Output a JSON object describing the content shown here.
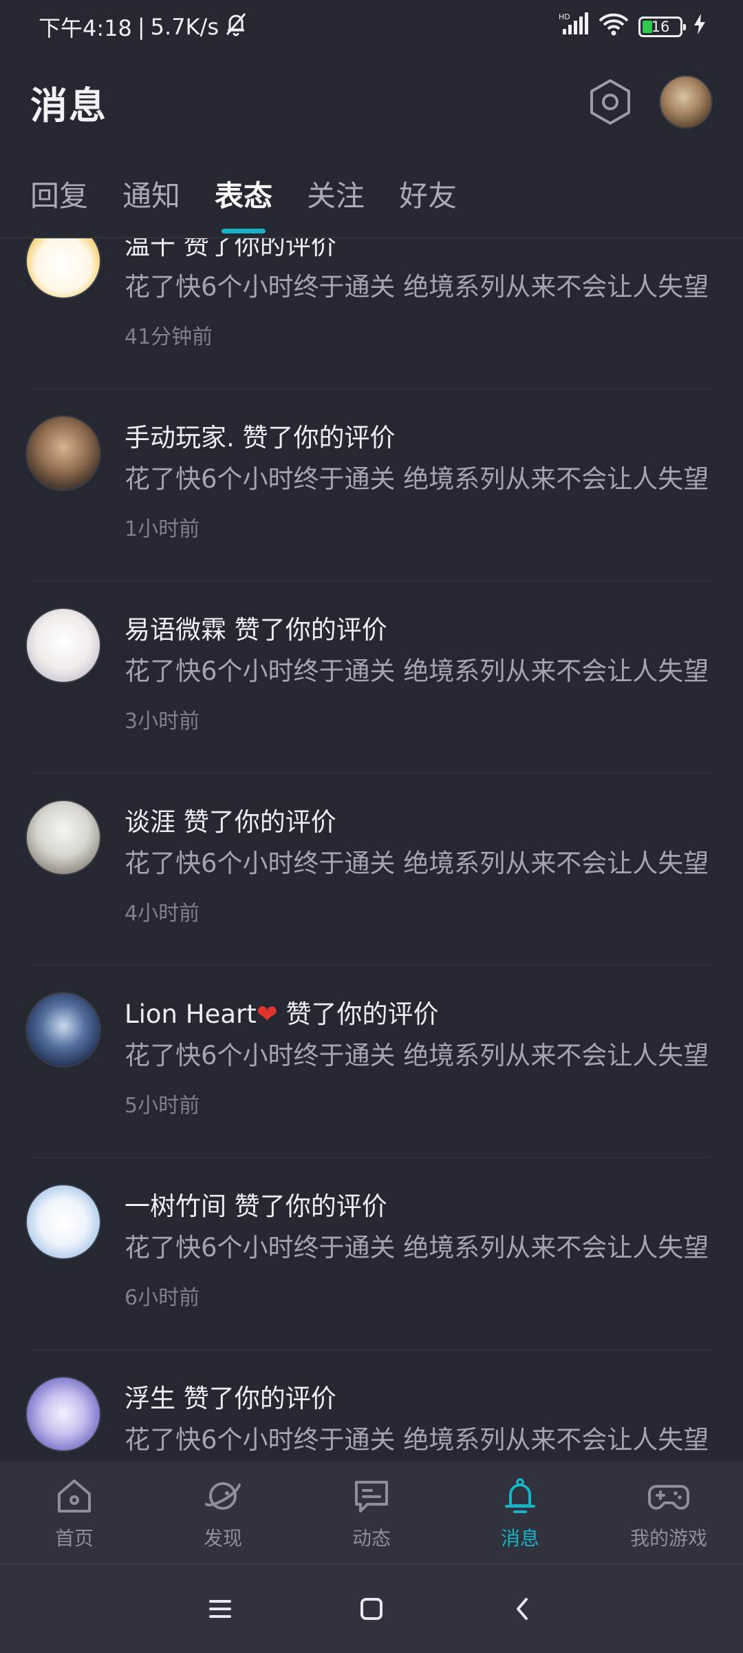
{
  "status_bar": {
    "time": "下午4:18",
    "separator": "|",
    "speed": "5.7K/s",
    "battery": "16",
    "network": "HD"
  },
  "header": {
    "title": "消息"
  },
  "tabs": [
    {
      "label": "回复"
    },
    {
      "label": "通知"
    },
    {
      "label": "表态"
    },
    {
      "label": "关注"
    },
    {
      "label": "好友"
    }
  ],
  "items": [
    {
      "user": "温十",
      "action": "赞了你的评价",
      "body": "花了快6个小时终于通关 绝境系列从来不会让人失望",
      "time": "41分钟前"
    },
    {
      "user": "手动玩家.",
      "action": "赞了你的评价",
      "body": "花了快6个小时终于通关 绝境系列从来不会让人失望",
      "time": "1小时前"
    },
    {
      "user": "易语微霖",
      "action": "赞了你的评价",
      "body": "花了快6个小时终于通关 绝境系列从来不会让人失望",
      "time": "3小时前"
    },
    {
      "user": "谈涯",
      "action": "赞了你的评价",
      "body": "花了快6个小时终于通关 绝境系列从来不会让人失望",
      "time": "4小时前"
    },
    {
      "user": "Lion Heart",
      "user_suffix": "❤",
      "action": "赞了你的评价",
      "body": "花了快6个小时终于通关 绝境系列从来不会让人失望",
      "time": "5小时前"
    },
    {
      "user": "一树竹间",
      "action": "赞了你的评价",
      "body": "花了快6个小时终于通关 绝境系列从来不会让人失望",
      "time": "6小时前"
    },
    {
      "user": "浮生",
      "action": "赞了你的评价",
      "body": "花了快6个小时终于通关 绝境系列从来不会让人失望",
      "time": ""
    }
  ],
  "bottom_nav": [
    {
      "label": "首页",
      "icon": "home-icon"
    },
    {
      "label": "发现",
      "icon": "discover-planet-icon"
    },
    {
      "label": "动态",
      "icon": "feed-chat-icon"
    },
    {
      "label": "消息",
      "icon": "bell-icon"
    },
    {
      "label": "我的游戏",
      "icon": "gamepad-icon"
    }
  ],
  "colors": {
    "background": "#252731",
    "accent": "#18b3c4",
    "nav_background": "#30323e"
  }
}
